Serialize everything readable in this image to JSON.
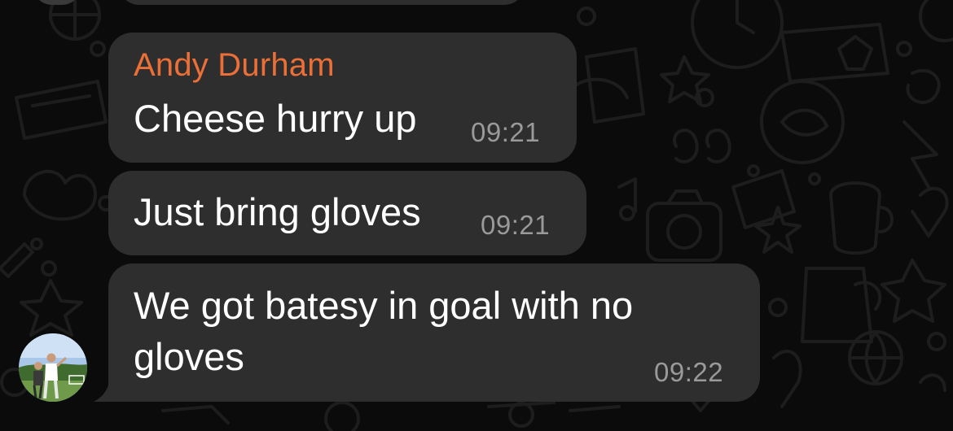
{
  "theme": {
    "sender_color": "#ec6f38",
    "bubble_color": "#2e2e2e",
    "time_color": "#9a9a9a",
    "background_color": "#0b0b0b"
  },
  "messages": [
    {
      "sender": "Andy Durham",
      "text": "Cheese hurry up",
      "time": "09:21"
    },
    {
      "text": "Just bring gloves",
      "time": "09:21"
    },
    {
      "text_line1": "We got batesy in goal with no",
      "text_line2": "gloves",
      "time": "09:22"
    }
  ],
  "avatar": {
    "icon": "user-photo-icon"
  }
}
